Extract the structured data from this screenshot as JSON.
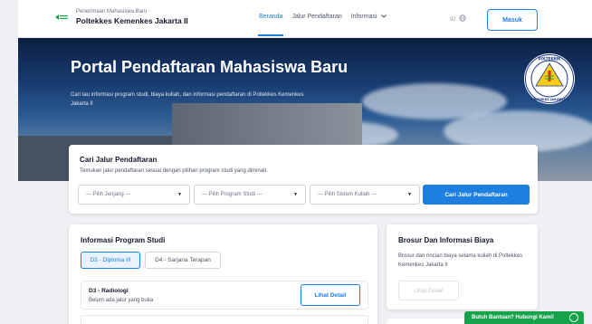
{
  "brand": {
    "subtitle": "Penerimaan Mahasiswa Baru",
    "name": "Poltekkes Kemenkes Jakarta II"
  },
  "nav": {
    "items": [
      {
        "label": "Beranda",
        "active": true
      },
      {
        "label": "Jalur Pendaftaran",
        "active": false
      },
      {
        "label": "Informasi",
        "active": false
      }
    ],
    "lang": "ID",
    "login_label": "Masuk"
  },
  "hero": {
    "title": "Portal Pendaftaran Mahasiswa Baru",
    "subtitle": "Cari tau informasi program studi, biaya kuliah, dan informasi pendaftaran di Poltekkes Kemenkes Jakarta II",
    "seal_text_top": "POLTEKNIK KESEHATAN",
    "seal_text_bottom": "KEMENKES JAKARTA II"
  },
  "search": {
    "title": "Cari Jalur Pendaftaran",
    "description": "Temukan jalur pendaftaran sesuai dengan pilihan program studi yang diminati.",
    "selects": [
      {
        "placeholder": "--- Pilih Jenjang ---"
      },
      {
        "placeholder": "--- Pilih Program Studi ---"
      },
      {
        "placeholder": "--- Pilih Sistem Kuliah ---"
      }
    ],
    "button_label": "Cari Jalur Pendaftaran"
  },
  "info": {
    "title": "Informasi Program Studi",
    "tabs": [
      {
        "label": "D3 - Diploma III",
        "active": true
      },
      {
        "label": "D4 - Sarjana Terapan",
        "active": false
      }
    ],
    "programs": [
      {
        "name": "D3 - Radiologi",
        "status": "Belum ada jalur yang buka",
        "button_label": "Lihat Detail"
      }
    ]
  },
  "brosur": {
    "title": "Brosur Dan Informasi Biaya",
    "description": "Brosur dan rincian biaya selama kuliah di Poltekkes Kemenkes Jakarta II",
    "button_label": "Lihat Detail"
  },
  "help": {
    "label": "Butuh Bantuan? Hubungi Kami!"
  },
  "colors": {
    "primary": "#1d7fe0",
    "help_green": "#16a34a"
  },
  "icons": {
    "brand": "kemenkes-logo-icon",
    "lang": "globe-icon",
    "chevron": "chevron-down-icon",
    "help": "whatsapp-icon"
  }
}
